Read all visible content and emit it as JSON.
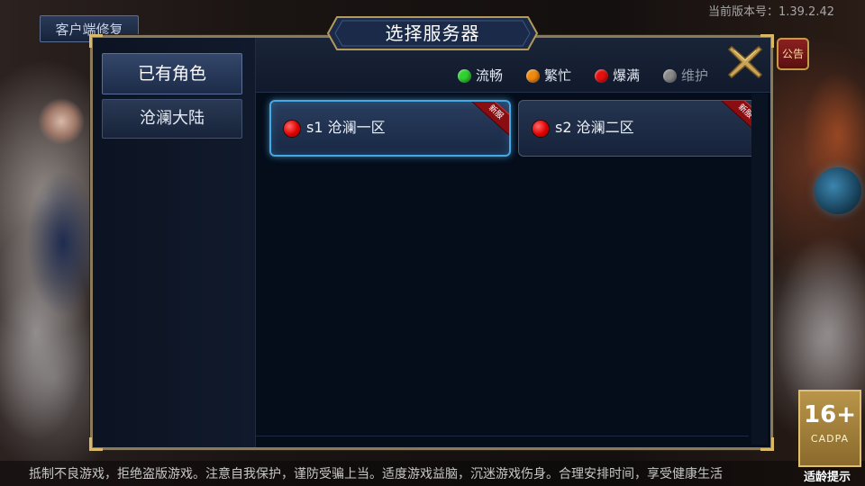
{
  "top": {
    "repair_button": "客户端修复",
    "version": "当前版本号：1.39.2.42",
    "notice_label": "公告"
  },
  "dialog": {
    "title": "选择服务器",
    "sidebar": [
      {
        "label": "已有角色",
        "active": true
      },
      {
        "label": "沧澜大陆",
        "active": false
      }
    ],
    "legend": [
      {
        "label": "流畅",
        "color": "#2fd12f",
        "status": "smooth"
      },
      {
        "label": "繁忙",
        "color": "#f08a10",
        "status": "busy"
      },
      {
        "label": "爆满",
        "color": "#e51010",
        "status": "full"
      },
      {
        "label": "维护",
        "color": "#8a8a8a",
        "status": "maintenance"
      }
    ],
    "servers": [
      {
        "name": "s1 沧澜一区",
        "status": "full",
        "status_color": "#e51010",
        "tag": "新服",
        "selected": true
      },
      {
        "name": "s2 沧澜二区",
        "status": "full",
        "status_color": "#e51010",
        "tag": "新服",
        "selected": false
      }
    ],
    "close_icon": "close-x-icon"
  },
  "footer": {
    "warning": "抵制不良游戏，拒绝盗版游戏。注意自我保护，谨防受骗上当。适度游戏益脑，沉迷游戏伤身。合理安排时间，享受健康生活",
    "age_rating": "16+",
    "age_org": "CADPA",
    "age_tip": "适龄提示"
  },
  "colors": {
    "frame_gold": "#8a7a5a",
    "selected_glow": "#46a9e4",
    "panel_bg": "#0f1726"
  }
}
